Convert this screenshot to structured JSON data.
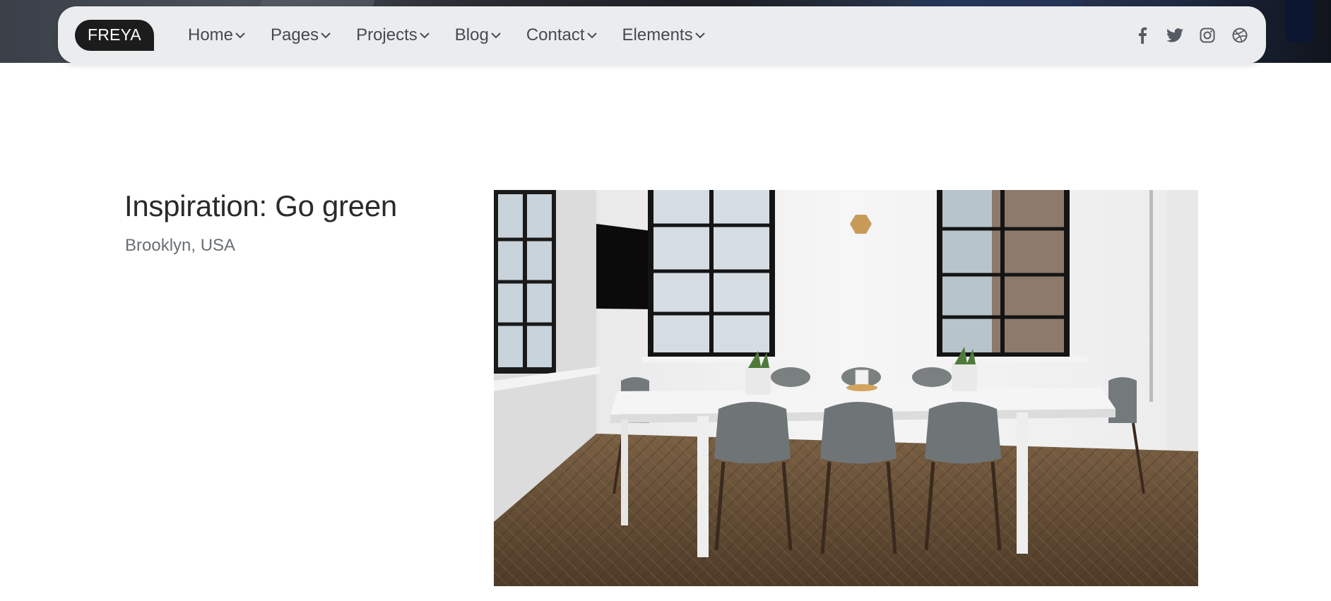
{
  "brand": {
    "logo_text": "FREYA"
  },
  "nav": {
    "items": [
      {
        "label": "Home"
      },
      {
        "label": "Pages"
      },
      {
        "label": "Projects"
      },
      {
        "label": "Blog"
      },
      {
        "label": "Contact"
      },
      {
        "label": "Elements"
      }
    ],
    "social": [
      "facebook-icon",
      "twitter-icon",
      "instagram-icon",
      "dribbble-icon"
    ]
  },
  "project": {
    "title": "Inspiration: Go green",
    "location": "Brooklyn, USA"
  },
  "colors": {
    "nav_bg": "#ebecee",
    "logo_bg": "#1c1c1c",
    "nav_text": "#444a52",
    "title": "#2a2a2a",
    "subtitle": "#6a6f75"
  }
}
